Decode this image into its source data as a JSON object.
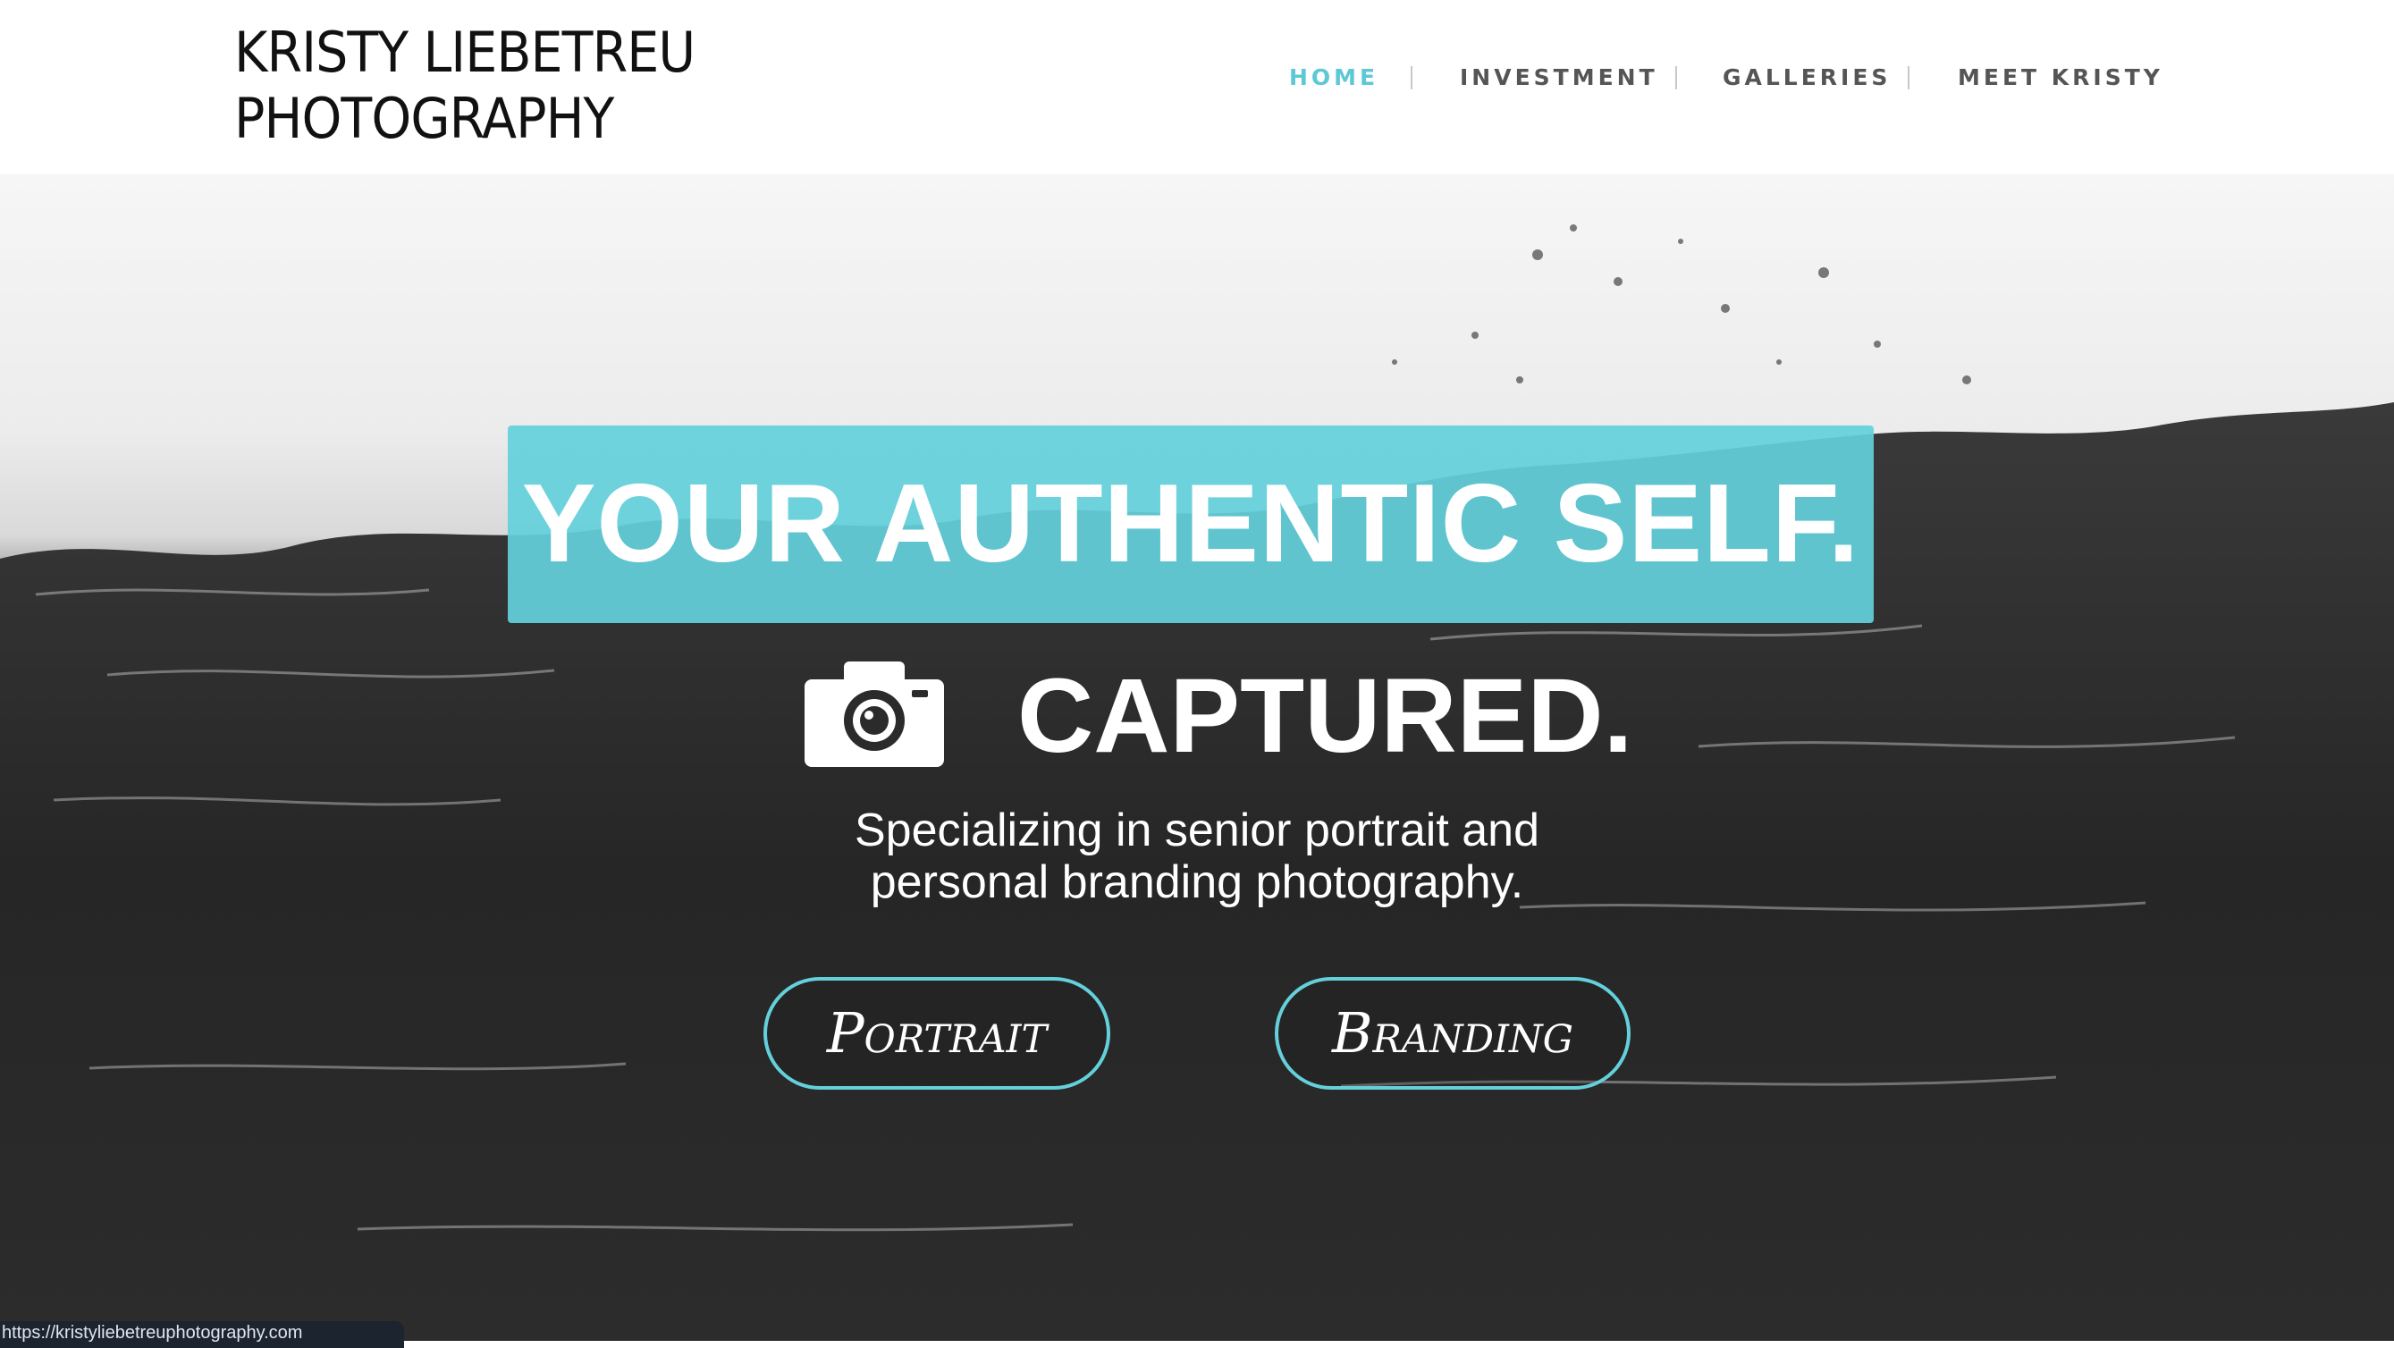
{
  "logo": {
    "line1": "KRISTY LIEBETREU",
    "line2": "PHOTOGRAPHY"
  },
  "nav": {
    "items": [
      {
        "label": "HOME",
        "active": true
      },
      {
        "label": "INVESTMENT",
        "active": false
      },
      {
        "label": "GALLERIES",
        "active": false
      },
      {
        "label": "MEET KRISTY",
        "active": false
      }
    ]
  },
  "hero": {
    "headline": "YOUR AUTHENTIC SELF.",
    "captured": "CAPTURED.",
    "camera_icon": "camera-icon",
    "tagline_line1": "Specializing in senior portrait and",
    "tagline_line2": "personal branding photography.",
    "buttons": {
      "portrait": "Portrait",
      "branding": "Branding"
    }
  },
  "status_bar": {
    "url": "https://kristyliebetreuphotography.com"
  },
  "colors": {
    "accent": "#64d0db",
    "nav_text": "#555555",
    "header_bg": "#ffffff"
  }
}
